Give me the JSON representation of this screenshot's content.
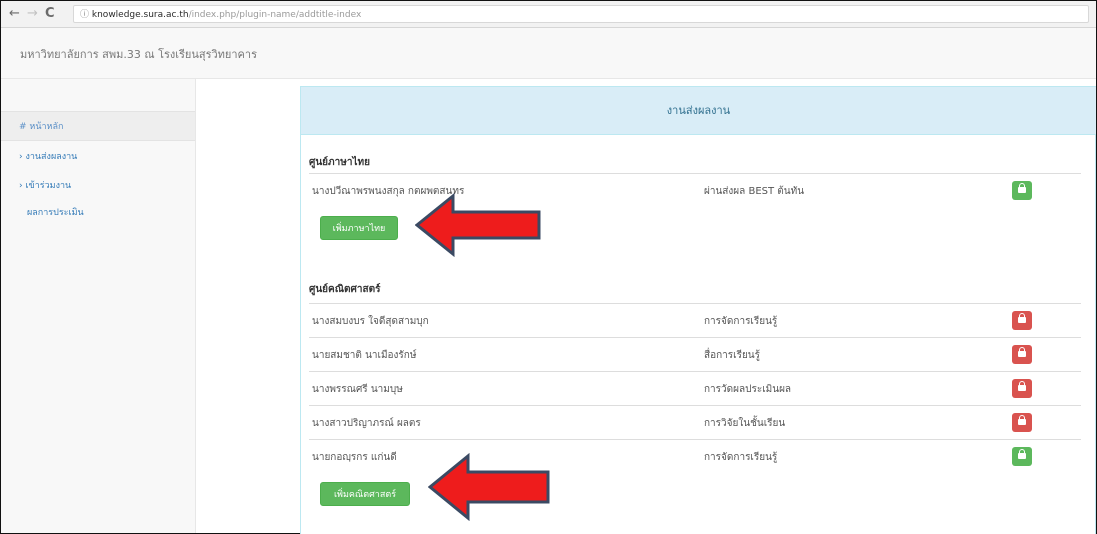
{
  "browser": {
    "back_glyph": "←",
    "forward_glyph": "→",
    "reload_glyph": "C",
    "info_glyph": "ⓘ",
    "url_host": "knowledge.sura.ac.th",
    "url_path": "/index.php/plugin-name/addtitle-index"
  },
  "header": {
    "site_title": "มหาวิทยาลัยการ สพม.33 ณ โรงเรียนสุรวิทยาคาร"
  },
  "sidebar": {
    "items": [
      {
        "label": "# หน้าหลัก"
      },
      {
        "label": "› งานส่งผลงาน"
      },
      {
        "label": "› เข้าร่วมงาน"
      },
      {
        "label": "ผลการประเมิน"
      }
    ]
  },
  "panel": {
    "heading": "งานส่งผลงาน",
    "sections": [
      {
        "title": "ศูนย์ภาษาไทย",
        "rows": [
          {
            "name": "นางปวีณาพรพนงสกุล กตผพตสนทร",
            "status": "ผ่านส่งผล BEST ต้นทัน",
            "action_color": "green"
          }
        ],
        "add_label": "เพิ่มภาษาไทย"
      },
      {
        "title": "ศูนย์คณิตศาสตร์",
        "rows": [
          {
            "name": "นางสมบงบร ใจดีสุดสามบุก",
            "status": "การจัดการเรียนรู้",
            "action_color": "red"
          },
          {
            "name": "นายสมชาติ นาเมืองรักษ์",
            "status": "สื่อการเรียนรู้",
            "action_color": "red"
          },
          {
            "name": "นางพรรณศรี นามบุษ",
            "status": "การวัดผลประเมินผล",
            "action_color": "red"
          },
          {
            "name": "นางสาวปริญาภรณ์ ผลตร",
            "status": "การวิจัยในชั้นเรียน",
            "action_color": "red"
          },
          {
            "name": "นายกอญฺรกร แก่นดี",
            "status": "การจัดการเรียนรู้",
            "action_color": "green"
          }
        ],
        "add_label": "เพิ่มคณิตศาสตร์"
      }
    ]
  },
  "colors": {
    "green": "#5cb85c",
    "red": "#d9534f",
    "arrow_red": "#ee1c1c",
    "arrow_outline": "#3b4a63",
    "panel_heading": "#d9edf7"
  },
  "icons": {
    "row_action": "lock-icon",
    "annotation": "red-arrow-icon"
  }
}
